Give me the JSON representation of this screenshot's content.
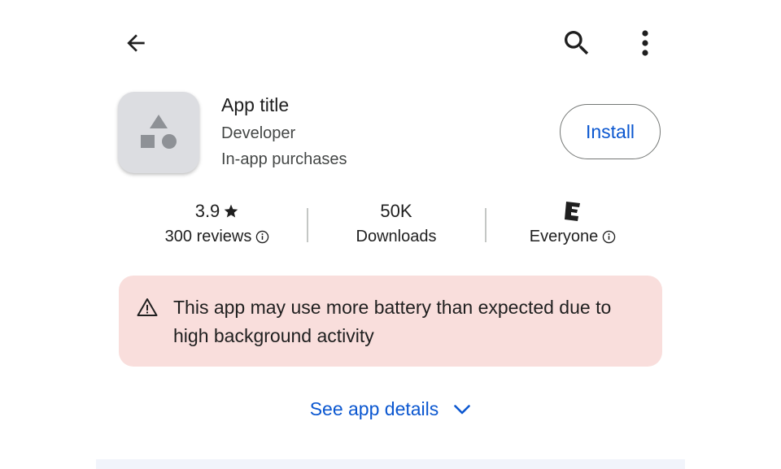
{
  "app": {
    "title": "App title",
    "developer": "Developer",
    "in_app_purchases": "In-app purchases"
  },
  "actions": {
    "install_label": "Install"
  },
  "stats": {
    "rating": {
      "value": "3.9",
      "label": "300 reviews"
    },
    "downloads": {
      "value": "50K",
      "label": "Downloads"
    },
    "content_rating": {
      "badge": "E",
      "label": "Everyone"
    }
  },
  "warning": {
    "text": "This app may use more battery than expected due to high background activity"
  },
  "details_link": {
    "label": "See app details"
  },
  "colors": {
    "accent": "#0b57d0",
    "warning_bg": "#f9dedc",
    "icon_bg": "#dcdde1"
  },
  "icons": [
    "back-arrow-icon",
    "search-icon",
    "more-vert-icon",
    "app-placeholder-icon",
    "star-icon",
    "info-icon",
    "esrb-e-icon",
    "warning-icon",
    "chevron-down-icon"
  ]
}
